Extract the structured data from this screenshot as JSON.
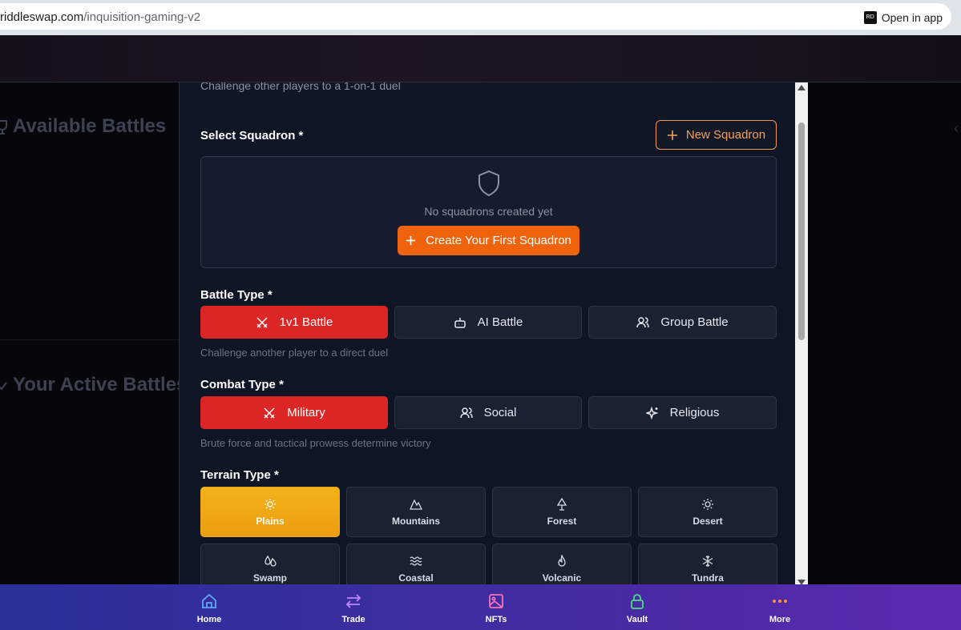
{
  "browser": {
    "url_domain": "riddleswap.com",
    "url_path": "/inquisition-gaming-v2",
    "open_in_app": "Open in app"
  },
  "background": {
    "available_battles": "Available Battles",
    "active_battles": "Your Active Battles"
  },
  "modal": {
    "subtitle": "Challenge other players to a 1-on-1 duel",
    "squadron": {
      "label": "Select Squadron *",
      "new_button": "New Squadron",
      "empty_text": "No squadrons created yet",
      "create_button": "Create Your First Squadron"
    },
    "battle_type": {
      "label": "Battle Type *",
      "options": [
        {
          "label": "1v1 Battle",
          "icon": "swords-icon",
          "selected": true
        },
        {
          "label": "AI Battle",
          "icon": "bot-icon",
          "selected": false
        },
        {
          "label": "Group Battle",
          "icon": "users-icon",
          "selected": false
        }
      ],
      "hint": "Challenge another player to a direct duel"
    },
    "combat_type": {
      "label": "Combat Type *",
      "options": [
        {
          "label": "Military",
          "icon": "swords-icon",
          "selected": true
        },
        {
          "label": "Social",
          "icon": "users-icon",
          "selected": false
        },
        {
          "label": "Religious",
          "icon": "sparkles-icon",
          "selected": false
        }
      ],
      "hint": "Brute force and tactical prowess determine victory"
    },
    "terrain_type": {
      "label": "Terrain Type *",
      "options": [
        {
          "label": "Plains",
          "icon": "sun-icon",
          "selected": true
        },
        {
          "label": "Mountains",
          "icon": "mountain-icon",
          "selected": false
        },
        {
          "label": "Forest",
          "icon": "tree-icon",
          "selected": false
        },
        {
          "label": "Desert",
          "icon": "sun-icon",
          "selected": false
        },
        {
          "label": "Swamp",
          "icon": "droplets-icon",
          "selected": false
        },
        {
          "label": "Coastal",
          "icon": "waves-icon",
          "selected": false
        },
        {
          "label": "Volcanic",
          "icon": "flame-icon",
          "selected": false
        },
        {
          "label": "Tundra",
          "icon": "snowflake-icon",
          "selected": false
        }
      ]
    }
  },
  "bottom_nav": {
    "items": [
      {
        "label": "Home",
        "icon": "home-icon",
        "color": "#60a5fa"
      },
      {
        "label": "Trade",
        "icon": "arrows-icon",
        "color": "#c084fc"
      },
      {
        "label": "NFTs",
        "icon": "image-icon",
        "color": "#f472b6"
      },
      {
        "label": "Vault",
        "icon": "lock-icon",
        "color": "#4ade80"
      },
      {
        "label": "More",
        "icon": "dots-icon",
        "color": "#fb923c"
      }
    ]
  },
  "colors": {
    "selected_red": "#dc2626",
    "selected_gold": "#f0a818",
    "primary_orange": "#f0630d",
    "modal_bg": "#0e1626"
  }
}
